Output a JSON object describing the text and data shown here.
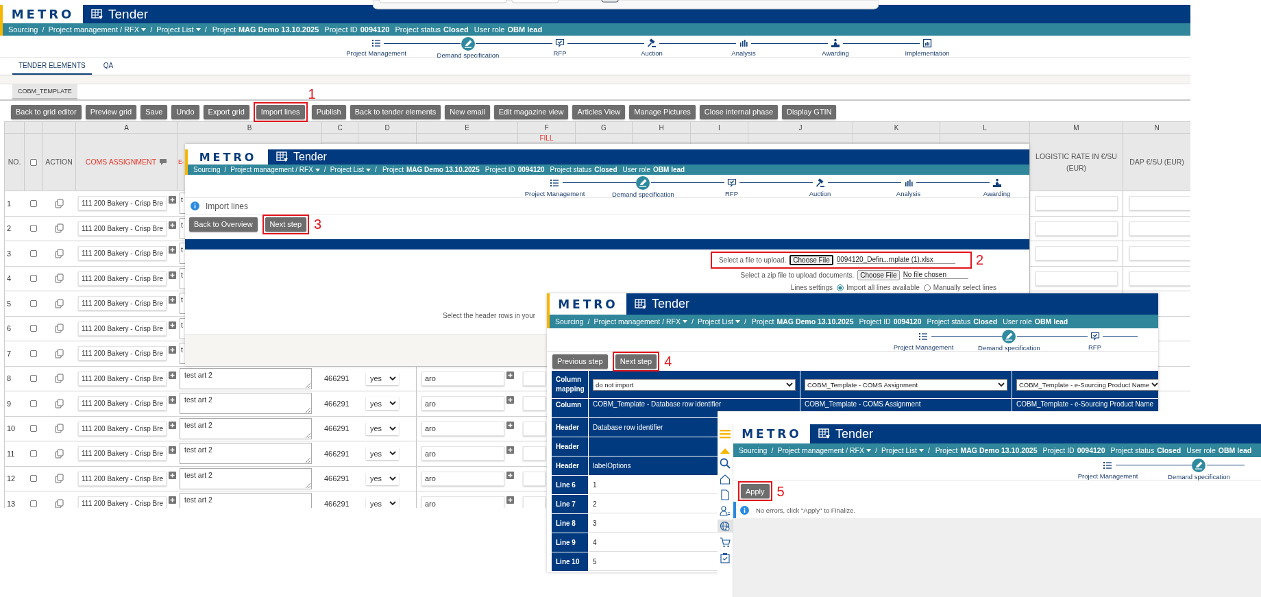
{
  "main": {
    "header": {
      "logo": "METRO",
      "title": "Tender"
    },
    "breadcrumb": {
      "separator": "/",
      "path": [
        {
          "label": "Sourcing",
          "dropdown": false
        },
        {
          "label": "Project management / RFX",
          "dropdown": true
        },
        {
          "label": "Project List",
          "dropdown": true
        }
      ],
      "facts": [
        {
          "label": "Project",
          "value": "MAG Demo 13.10.2025"
        },
        {
          "label": "Project ID",
          "value": "0094120"
        },
        {
          "label": "Project status",
          "value": "Closed"
        },
        {
          "label": "User role",
          "value": "OBM lead"
        }
      ]
    },
    "steps": [
      {
        "label": "Project Management",
        "current": false
      },
      {
        "label": "Demand specification",
        "current": true
      },
      {
        "label": "RFP",
        "current": false
      },
      {
        "label": "Auction",
        "current": false
      },
      {
        "label": "Analysis",
        "current": false
      },
      {
        "label": "Awarding",
        "current": false
      },
      {
        "label": "Implementation",
        "current": false
      }
    ],
    "tabs": [
      {
        "label": "TENDER ELEMENTS",
        "selected": true
      },
      {
        "label": "QA",
        "selected": false
      }
    ],
    "sub_tabs": [
      {
        "label": "COBM_TEMPLATE",
        "selected": true
      }
    ],
    "toolbar": [
      {
        "label": "Back to grid editor",
        "highlighted": false
      },
      {
        "label": "Preview grid",
        "highlighted": false
      },
      {
        "label": "Save",
        "highlighted": false
      },
      {
        "label": "Undo",
        "highlighted": false
      },
      {
        "label": "Export grid",
        "highlighted": false
      },
      {
        "label": "Import lines",
        "highlighted": true,
        "annotation": "1"
      },
      {
        "label": "Publish",
        "highlighted": false
      },
      {
        "label": "Back to tender elements",
        "highlighted": false
      },
      {
        "label": "New email",
        "highlighted": false
      },
      {
        "label": "Edit magazine view",
        "highlighted": false
      },
      {
        "label": "Articles View",
        "highlighted": false
      },
      {
        "label": "Manage Pictures",
        "highlighted": false
      },
      {
        "label": "Close internal phase",
        "highlighted": false
      },
      {
        "label": "Display GTIN",
        "highlighted": false
      }
    ],
    "grid": {
      "letters": [
        "A",
        "B",
        "C",
        "D",
        "E",
        "F",
        "G",
        "H",
        "I",
        "J",
        "K",
        "L",
        "M",
        "N"
      ],
      "fill_label": "FILL",
      "select_all_checked": false,
      "headers": {
        "no": "NO.",
        "action": "ACTION",
        "coms": "COMS ASSIGNMENT",
        "column_b": "E-",
        "logistic_rate": "LOGISTIC RATE IN €/SU (EUR)",
        "dap": "DAP €/SU (EUR)"
      },
      "rows": [
        {
          "no": "1",
          "checked": false,
          "coms": "111 200 Bakery - Crisp Bre",
          "column_b": "t",
          "rate_fields": true
        },
        {
          "no": "2",
          "checked": false,
          "coms": "111 200 Bakery - Crisp Bre",
          "column_b": "t",
          "rate_fields": true
        },
        {
          "no": "3",
          "checked": false,
          "coms": "111 200 Bakery - Crisp Bre",
          "column_b": "t",
          "rate_fields": true
        },
        {
          "no": "4",
          "checked": false,
          "coms": "111 200 Bakery - Crisp Bre",
          "column_b": "t",
          "rate_fields": true
        },
        {
          "no": "5",
          "checked": false,
          "coms": "111 200 Bakery - Crisp Bre",
          "column_b": "t",
          "rate_fields": false
        },
        {
          "no": "6",
          "checked": false,
          "coms": "111 200 Bakery - Crisp Bre",
          "column_b": "t",
          "rate_fields": false
        },
        {
          "no": "7",
          "checked": false,
          "coms": "111 200 Bakery - Crisp Bre",
          "column_b": "t",
          "rate_fields": false
        },
        {
          "no": "8",
          "checked": false,
          "coms": "111 200 Bakery - Crisp Bre",
          "column_b": "test art 2",
          "column_c": "466291",
          "column_d": "yes",
          "column_e": "aro",
          "rate_fields": false
        },
        {
          "no": "9",
          "checked": false,
          "coms": "111 200 Bakery - Crisp Bre",
          "column_b": "test art 2",
          "column_c": "466291",
          "column_d": "yes",
          "column_e": "aro",
          "rate_fields": false
        },
        {
          "no": "10",
          "checked": false,
          "coms": "111 200 Bakery - Crisp Bre",
          "column_b": "test art 2",
          "column_c": "466291",
          "column_d": "yes",
          "column_e": "aro",
          "rate_fields": false
        },
        {
          "no": "11",
          "checked": false,
          "coms": "111 200 Bakery - Crisp Bre",
          "column_b": "test art 2",
          "column_c": "466291",
          "column_d": "yes",
          "column_e": "aro",
          "rate_fields": false
        },
        {
          "no": "12",
          "checked": false,
          "coms": "111 200 Bakery - Crisp Bre",
          "column_b": "test art 2",
          "column_c": "466291",
          "column_d": "yes",
          "column_e": "aro",
          "rate_fields": false
        },
        {
          "no": "13",
          "checked": false,
          "coms": "111 200 Bakery - Crisp Bre",
          "column_b": "test art 2",
          "column_c": "466291",
          "column_d": "yes",
          "column_e": "aro",
          "rate_fields": false
        }
      ]
    }
  },
  "import_panel": {
    "header": {
      "logo": "METRO",
      "title": "Tender"
    },
    "breadcrumb": {
      "separator": "/",
      "path": [
        {
          "label": "Sourcing",
          "dropdown": false
        },
        {
          "label": "Project management / RFX",
          "dropdown": true
        },
        {
          "label": "Project List",
          "dropdown": true
        }
      ],
      "facts": [
        {
          "label": "Project",
          "value": "MAG Demo 13.10.2025"
        },
        {
          "label": "Project ID",
          "value": "0094120"
        },
        {
          "label": "Project status",
          "value": "Closed"
        },
        {
          "label": "User role",
          "value": "OBM lead"
        }
      ]
    },
    "steps": [
      {
        "label": "Project Management",
        "current": false
      },
      {
        "label": "Demand specification",
        "current": true
      },
      {
        "label": "RFP",
        "current": false
      },
      {
        "label": "Auction",
        "current": false
      },
      {
        "label": "Analysis",
        "current": false
      },
      {
        "label": "Awarding",
        "current": false
      }
    ],
    "notice": "Import lines",
    "buttons": [
      {
        "label": "Back to Overview",
        "highlighted": false
      },
      {
        "label": "Next step",
        "highlighted": true,
        "annotation": "3"
      }
    ],
    "upload": {
      "label": "Select a file to upload.",
      "button": "Choose File",
      "focused": true,
      "file": "0094120_Defin...mplate (1).xlsx",
      "highlighted": true,
      "annotation": "2"
    },
    "zip_upload": {
      "label": "Select a zip file to upload documents.",
      "button": "Choose File",
      "focused": false,
      "file": "No file chosen",
      "highlighted": false
    },
    "lines_settings": {
      "label": "Lines settings",
      "options": [
        {
          "label": "Import all lines available",
          "selected": true
        },
        {
          "label": "Manually select lines",
          "selected": false
        }
      ]
    },
    "hint": "Select the header rows in your"
  },
  "mapping_panel": {
    "header": {
      "logo": "METRO",
      "title": "Tender"
    },
    "breadcrumb": {
      "separator": "/",
      "path": [
        {
          "label": "Sourcing",
          "dropdown": false
        },
        {
          "label": "Project management / RFX",
          "dropdown": true
        },
        {
          "label": "Project List",
          "dropdown": true
        }
      ],
      "facts": [
        {
          "label": "Project",
          "value": "MAG Demo 13.10.2025"
        },
        {
          "label": "Project ID",
          "value": "0094120"
        },
        {
          "label": "Project status",
          "value": "Closed"
        },
        {
          "label": "User role",
          "value": "OBM lead"
        }
      ]
    },
    "steps": [
      {
        "label": "Project Management",
        "current": false
      },
      {
        "label": "Demand specification",
        "current": true
      },
      {
        "label": "RFP",
        "current": false
      }
    ],
    "steps_continue": true,
    "buttons": [
      {
        "label": "Previous step",
        "highlighted": false
      },
      {
        "label": "Next step",
        "highlighted": true,
        "annotation": "4"
      }
    ],
    "rows": [
      {
        "label": "Column mapping",
        "kind": "select",
        "values": [
          "do not import",
          "COBM_Template - COMS Assignment",
          "COBM_Template - e-Sourcing Product Name"
        ]
      },
      {
        "label": "Column",
        "kind": "heading",
        "values": [
          "COBM_Template - Database row identifier",
          "COBM_Template - COMS Assignment",
          "COBM_Template - e-Sourcing Product Name"
        ]
      },
      {
        "label": "Header",
        "kind": "heading",
        "values": [
          "Database row identifier"
        ]
      },
      {
        "label": "Header",
        "kind": "heading"
      },
      {
        "label": "Header",
        "kind": "heading",
        "values": [
          "labelOptions"
        ]
      },
      {
        "label": "Line 6",
        "kind": "line",
        "values": [
          "1"
        ]
      },
      {
        "label": "Line 7",
        "kind": "line",
        "values": [
          "2"
        ]
      },
      {
        "label": "Line 8",
        "kind": "line",
        "values": [
          "3"
        ]
      },
      {
        "label": "Line 9",
        "kind": "line",
        "values": [
          "4"
        ]
      },
      {
        "label": "Line 10",
        "kind": "line",
        "values": [
          "5"
        ]
      }
    ]
  },
  "apply_panel": {
    "sidebar": [
      {
        "selected": false
      },
      {
        "selected": false
      },
      {
        "selected": false
      },
      {
        "selected": false
      },
      {
        "selected": true
      },
      {
        "selected": false
      },
      {
        "selected": false
      }
    ],
    "header": {
      "logo": "METRO",
      "title": "Tender"
    },
    "breadcrumb": {
      "separator": "/",
      "path": [
        {
          "label": "Sourcing",
          "dropdown": false
        },
        {
          "label": "Project management / RFX",
          "dropdown": true
        },
        {
          "label": "Project List",
          "dropdown": true
        }
      ],
      "facts": [
        {
          "label": "Project",
          "value": "MAG Demo 13.10.2025"
        },
        {
          "label": "Project ID",
          "value": "0094120"
        },
        {
          "label": "Project status",
          "value": "Closed"
        },
        {
          "label": "User role",
          "value": "OBM lead"
        }
      ]
    },
    "steps": [
      {
        "label": "Project Management",
        "current": false
      },
      {
        "label": "Demand specification",
        "current": true
      }
    ],
    "steps_continue": true,
    "buttons": [
      {
        "label": "Apply",
        "highlighted": true,
        "annotation": "5"
      }
    ],
    "message": "No errors, click \"Apply\" to Finalize."
  }
}
